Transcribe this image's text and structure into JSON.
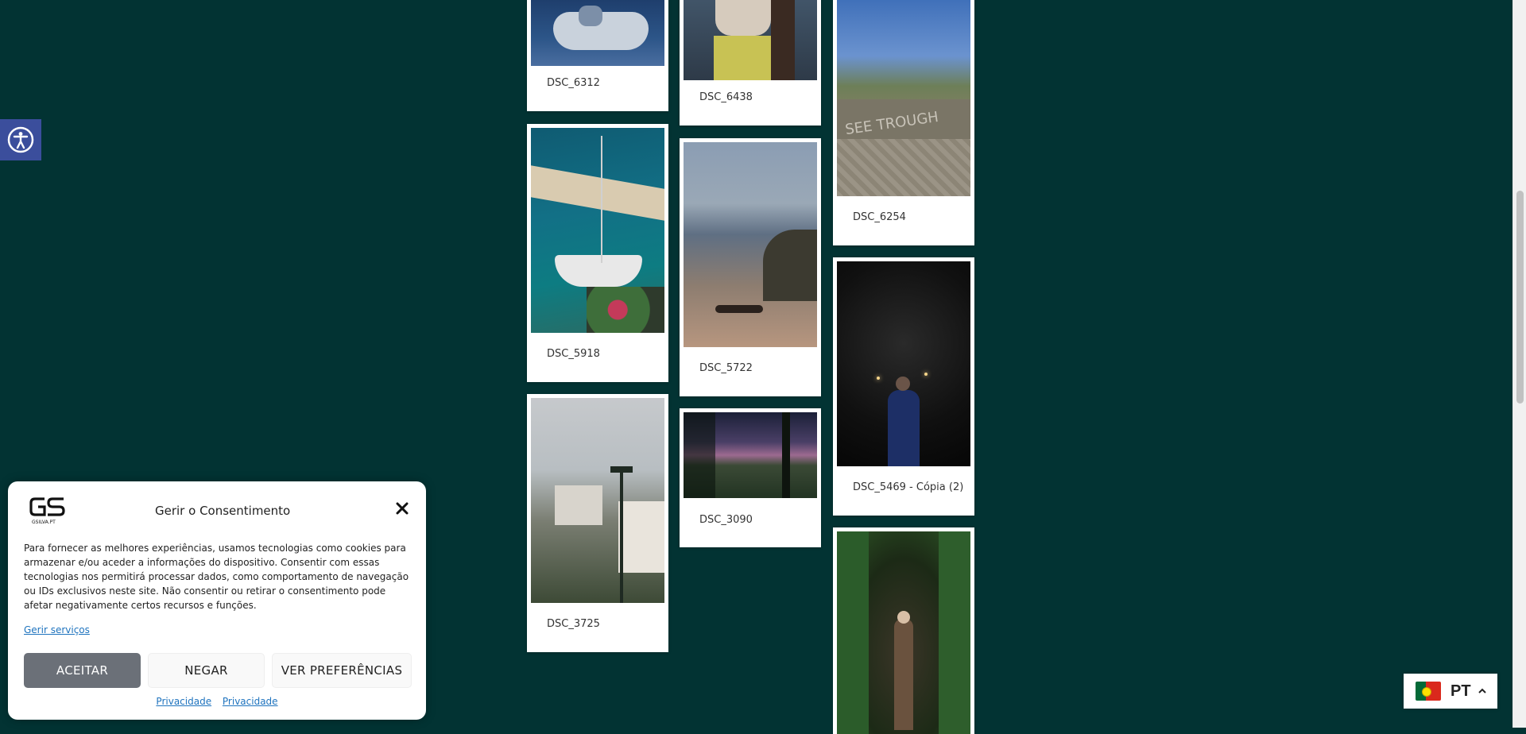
{
  "accessibility": {
    "icon": "accessibility-icon",
    "color": "#3b4e9c"
  },
  "gallery": {
    "items": [
      {
        "caption": "DSC_6312"
      },
      {
        "caption": "DSC_5918"
      },
      {
        "caption": "DSC_3725"
      },
      {
        "caption": "DSC_6438"
      },
      {
        "caption": "DSC_5722"
      },
      {
        "caption": "DSC_3090"
      },
      {
        "caption": "DSC_6254"
      },
      {
        "caption": "DSC_5469 - Cópia (2)"
      }
    ]
  },
  "consent": {
    "logo_text": "GSILVA.PT",
    "title": "Gerir o Consentimento",
    "body": "Para fornecer as melhores experiências, usamos tecnologias como cookies para armazenar e/ou aceder a informações do dispositivo. Consentir com essas tecnologias nos permitirá processar dados, como comportamento de navegação ou IDs exclusivos neste site. Não consentir ou retirar o consentimento pode afetar negativamente certos recursos e funções.",
    "manage_link": "Gerir serviços",
    "accept_label": "ACEITAR",
    "deny_label": "NEGAR",
    "prefs_label": "VER PREFERÊNCIAS",
    "privacy_link_1": "Privacidade",
    "privacy_link_2": "Privacidade"
  },
  "language": {
    "code": "PT",
    "flag": "portugal-flag-icon"
  },
  "colors": {
    "background": "#023333",
    "accent": "#1e73be"
  }
}
